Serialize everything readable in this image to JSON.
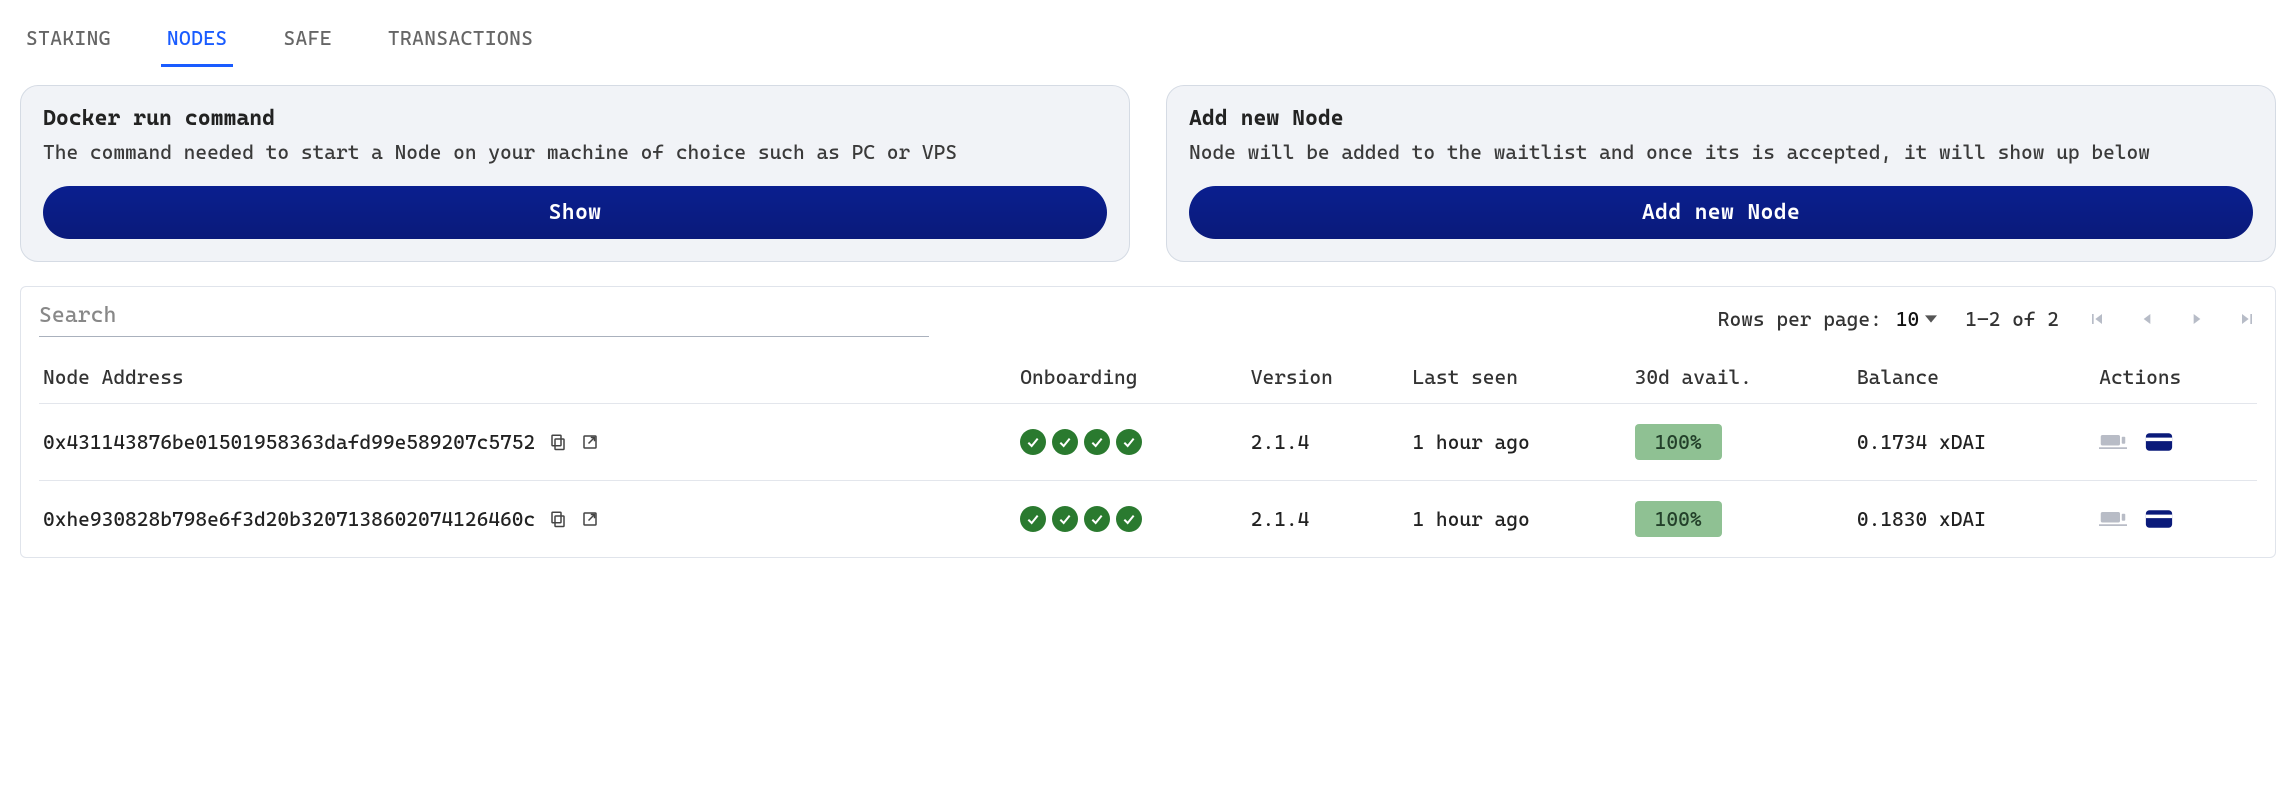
{
  "tabs": [
    "STAKING",
    "NODES",
    "SAFE",
    "TRANSACTIONS"
  ],
  "cards": {
    "docker": {
      "title": "Docker run command",
      "desc": "The command needed to start a Node on your machine of choice such as PC or VPS",
      "button": "Show"
    },
    "add_node": {
      "title": "Add new Node",
      "desc": "Node will be added to the waitlist and once its is accepted, it will show up below",
      "button": "Add new Node"
    }
  },
  "table": {
    "search_placeholder": "Search",
    "pager": {
      "rows_label": "Rows per page:",
      "rows_value": "10",
      "range": "1–2 of 2"
    },
    "columns": [
      "Node Address",
      "Onboarding",
      "Version",
      "Last seen",
      "30d avail.",
      "Balance",
      "Actions"
    ],
    "rows": [
      {
        "address": "0x431143876be01501958363dafd99e589207c5752",
        "onboarding_checks": 4,
        "version": "2.1.4",
        "last_seen": "1 hour ago",
        "availability": "100%",
        "balance": "0.1734 xDAI"
      },
      {
        "address": "0xhe930828b798e6f3d20b3207138602074126460c",
        "onboarding_checks": 4,
        "version": "2.1.4",
        "last_seen": "1 hour ago",
        "availability": "100%",
        "balance": "0.1830 xDAI"
      }
    ]
  }
}
